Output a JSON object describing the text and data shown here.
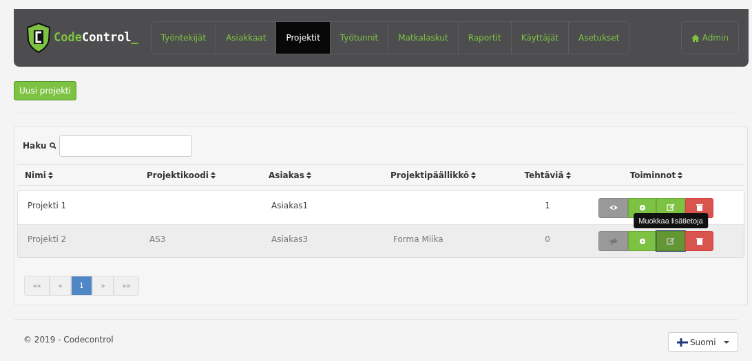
{
  "header": {
    "logo": {
      "parts": [
        {
          "text": "Code",
          "color": "#7dc242"
        },
        {
          "text": "Control",
          "color": "#ffffff"
        },
        {
          "text": "_",
          "color": "#7dc242"
        }
      ]
    },
    "nav": [
      {
        "label": "Työntekijät",
        "selected": false
      },
      {
        "label": "Asiakkaat",
        "selected": false
      },
      {
        "label": "Projektit",
        "selected": true
      },
      {
        "label": "Työtunnit",
        "selected": false
      },
      {
        "label": "Matkalaskut",
        "selected": false
      },
      {
        "label": "Raportit",
        "selected": false
      },
      {
        "label": "Käyttäjät",
        "selected": false
      },
      {
        "label": "Asetukset",
        "selected": false
      }
    ],
    "user": "Admin"
  },
  "new_button": "Uusi projekti",
  "search": {
    "label": "Haku"
  },
  "table": {
    "columns": [
      "Nimi",
      "Projektikoodi",
      "Asiakas",
      "Projektipäällikkö",
      "Tehtäviä",
      "Toiminnot"
    ],
    "rows": [
      {
        "cells": [
          "Projekti 1",
          "",
          "Asiakas1",
          "",
          "1"
        ],
        "highlighted": false,
        "actions": [
          {
            "kind": "view",
            "hovered": false
          },
          {
            "kind": "settings",
            "hovered": false
          },
          {
            "kind": "edit",
            "hovered": false
          },
          {
            "kind": "delete",
            "hovered": false
          }
        ]
      },
      {
        "cells": [
          "Projekti 2",
          "AS3",
          "Asiakas3",
          "Forma Miika",
          "0"
        ],
        "highlighted": true,
        "actions": [
          {
            "kind": "hidden",
            "hovered": false
          },
          {
            "kind": "settings",
            "hovered": false
          },
          {
            "kind": "edit",
            "hovered": true,
            "tooltip": "Muokkaa lisätietoja"
          },
          {
            "kind": "delete",
            "hovered": false
          }
        ]
      }
    ]
  },
  "pagination": [
    {
      "label": "««",
      "selected": false
    },
    {
      "label": "«",
      "selected": false
    },
    {
      "label": "1",
      "selected": true
    },
    {
      "label": "»",
      "selected": false
    },
    {
      "label": "»»",
      "selected": false
    }
  ],
  "footer": {
    "copyright": "© 2019 - Codecontrol",
    "language": "Suomi"
  }
}
